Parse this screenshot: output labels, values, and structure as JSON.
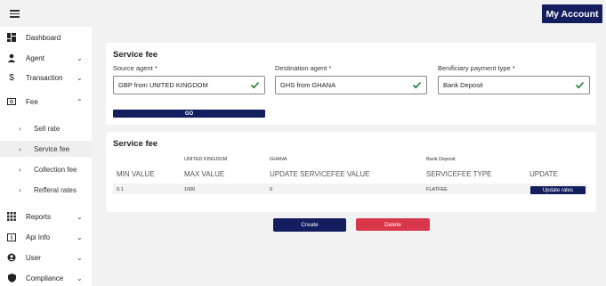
{
  "topbar": {
    "account_label": "My Account"
  },
  "colors": {
    "primary": "#141d5e",
    "danger": "#d9384a",
    "check": "#1e7d3c"
  },
  "sidebar": {
    "items": [
      {
        "label": "Dashboard",
        "icon": "dashboard-icon"
      },
      {
        "label": "Agent",
        "icon": "person-icon"
      },
      {
        "label": "Transaction",
        "icon": "dollar-icon"
      },
      {
        "label": "Fee",
        "icon": "cash-icon"
      },
      {
        "label": "Reports",
        "icon": "grid-icon"
      },
      {
        "label": "Api Info",
        "icon": "api-icon"
      },
      {
        "label": "User",
        "icon": "user-circle-icon"
      },
      {
        "label": "Compliance",
        "icon": "shield-icon"
      }
    ],
    "fee_subitems": [
      {
        "label": "Sell rate"
      },
      {
        "label": "Service fee"
      },
      {
        "label": "Collection fee"
      },
      {
        "label": "Refferal rates"
      }
    ]
  },
  "form": {
    "title": "Service fee",
    "source_label": "Source agent *",
    "source_value": "GBP from UNITED KINGDOM",
    "destination_label": "Destination agent *",
    "destination_value": "GHS from GHANA",
    "payment_label": "Benificiary payment type *",
    "payment_value": "Bank Deposit",
    "go_label": "GO"
  },
  "fee_table": {
    "title": "Service fee",
    "context": [
      "UNITED KINGDOM",
      "GHANA",
      "Bank Deposit"
    ],
    "headers": [
      "MIN VALUE",
      "MAX VALUE",
      "UPDATE SERVICEFEE VALUE",
      "SERVICEFEE TYPE",
      "UPDATE"
    ],
    "rows": [
      {
        "min": "0.1",
        "max": "1000",
        "value": "0",
        "type": "FLATFEE",
        "action": "Update rates"
      }
    ]
  },
  "actions": {
    "create_label": "Create",
    "delete_label": "Delete"
  }
}
